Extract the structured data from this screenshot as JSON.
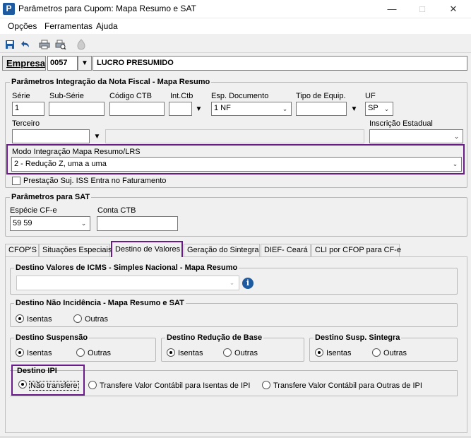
{
  "window": {
    "title": "Parâmetros para Cupom: Mapa Resumo e SAT",
    "app_letter": "P"
  },
  "menu": [
    "Opções",
    "Ferramentas",
    "Ajuda"
  ],
  "empresa": {
    "label": "Empresa",
    "code": "0057",
    "name": "LUCRO PRESUMIDO"
  },
  "nf": {
    "group_title": "Parâmetros Integração da Nota Fiscal - Mapa Resumo",
    "serie": {
      "label": "Série",
      "value": "1"
    },
    "sub_serie": {
      "label": "Sub-Série",
      "value": ""
    },
    "codigo_ctb": {
      "label": "Código CTB",
      "value": ""
    },
    "int_ctb": {
      "label": "Int.Ctb",
      "value": ""
    },
    "esp_documento": {
      "label": "Esp. Documento",
      "value": "1 NF"
    },
    "tipo_equip": {
      "label": "Tipo de Equip.",
      "value": ""
    },
    "uf": {
      "label": "UF",
      "value": "SP"
    },
    "terceiro": {
      "label": "Terceiro",
      "value": ""
    },
    "inscricao_estadual": {
      "label": "Inscrição Estadual",
      "value": ""
    },
    "modo": {
      "label": "Modo Integração Mapa Resumo/LRS",
      "value": "2 - Redução Z, uma a uma"
    },
    "prestacao": {
      "label": "Prestação Suj. ISS Entra no Faturamento",
      "checked": false
    }
  },
  "sat": {
    "group_title": "Parâmetros para SAT",
    "especie": {
      "label": "Espécie CF-e",
      "value": "59 59"
    },
    "conta_ctb": {
      "label": "Conta CTB",
      "value": ""
    }
  },
  "tabs": [
    "CFOP'S",
    "Situações Especiais",
    "Destino de Valores",
    "Geração do Sintegra",
    "DIEF- Ceará",
    "CLI por CFOP para CF-e"
  ],
  "active_tab": "Destino de Valores",
  "destino": {
    "icms": {
      "title": "Destino Valores de ICMS - Simples Nacional - Mapa Resumo",
      "value": ""
    },
    "nao_incidencia": {
      "title": "Destino Não Incidência - Mapa Resumo e SAT",
      "opt1": "Isentas",
      "opt2": "Outras",
      "selected": "Isentas"
    },
    "suspensao": {
      "title": "Destino Suspensão",
      "opt1": "Isentas",
      "opt2": "Outras",
      "selected": "Isentas"
    },
    "reducao": {
      "title": "Destino Redução de Base",
      "opt1": "Isentas",
      "opt2": "Outras",
      "selected": "Isentas"
    },
    "susp_sintegra": {
      "title": "Destino Susp. Sintegra",
      "opt1": "Isentas",
      "opt2": "Outras",
      "selected": "Isentas"
    },
    "ipi": {
      "title": "Destino IPI",
      "opt1": "Não transfere",
      "opt2": "Transfere Valor Contábil para Isentas de IPI",
      "opt3": "Transfere Valor Contábil para Outras de IPI",
      "selected": "Não transfere"
    }
  },
  "icons": [
    "save-icon",
    "undo-icon",
    "print-icon",
    "print-preview-icon",
    "disabled-icon",
    "info-icon"
  ],
  "colors": {
    "highlight": "#6a1b8a",
    "toolbar_blue": "#1e5aa0"
  }
}
